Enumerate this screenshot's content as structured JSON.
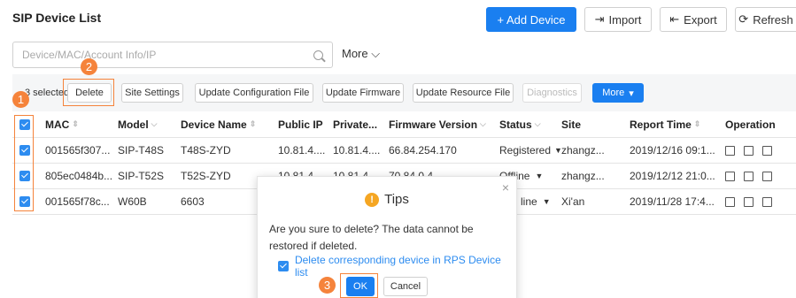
{
  "header": {
    "title": "SIP Device List",
    "add_device": "+ Add Device",
    "import": "Import",
    "export": "Export",
    "refresh": "Refresh"
  },
  "search": {
    "placeholder": "Device/MAC/Account Info/IP",
    "more": "More"
  },
  "toolbar": {
    "selected_text": "3 selected",
    "delete": "Delete",
    "site_settings": "Site Settings",
    "update_config": "Update Configuration File",
    "update_firmware": "Update Firmware",
    "update_resource": "Update Resource File",
    "diagnostics": "Diagnostics",
    "more": "More"
  },
  "table": {
    "columns": [
      "MAC",
      "Model",
      "Device Name",
      "Public IP",
      "Private...",
      "Firmware Version",
      "Status",
      "Site",
      "Report Time",
      "Operation"
    ],
    "rows": [
      {
        "mac": "001565f307...",
        "model": "SIP-T48S",
        "name": "T48S-ZYD",
        "public_ip": "10.81.4....",
        "private_ip": "10.81.4....",
        "firmware": "66.84.254.170",
        "status": "Registered",
        "site": "zhangz...",
        "report_time": "2019/12/16 09:1..."
      },
      {
        "mac": "805ec0484b...",
        "model": "SIP-T52S",
        "name": "T52S-ZYD",
        "public_ip": "10.81.4....",
        "private_ip": "10.81.4....",
        "firmware": "70.84.0.4",
        "status": "Offline",
        "site": "zhangz...",
        "report_time": "2019/12/12 21:0..."
      },
      {
        "mac": "001565f78c...",
        "model": "W60B",
        "name": "6603",
        "public_ip": "",
        "private_ip": "",
        "firmware": "",
        "status": "line",
        "site": "Xi'an",
        "report_time": "2019/11/28 17:4..."
      }
    ]
  },
  "dialog": {
    "title": "Tips",
    "message": "Are you sure to delete? The data cannot be restored if deleted.",
    "checkbox_label": "Delete corresponding device in RPS Device list",
    "ok": "OK",
    "cancel": "Cancel"
  },
  "markers": [
    "1",
    "2",
    "3"
  ],
  "colors": {
    "primary": "#1a7ff0",
    "marker": "#f5833b",
    "warning": "#f5a623"
  }
}
